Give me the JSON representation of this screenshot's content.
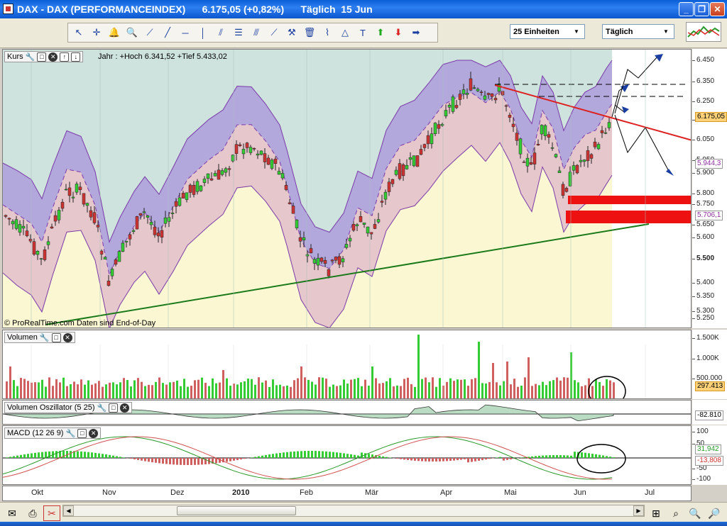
{
  "window": {
    "title": "DAX - DAX (PERFORMANCEINDEX)      6.175,05 (+0,82%)      Täglich  15 Jun",
    "buttons": [
      "_",
      "❐",
      "✕"
    ]
  },
  "toolbar": {
    "units_select": "25 Einheiten",
    "period_select": "Täglich",
    "tools": [
      "cursor-icon",
      "crosshair-icon",
      "alarm-bell-icon",
      "zoom-icon",
      "trendline-icon",
      "line-icon",
      "horizontal-line-icon",
      "vertical-line-icon",
      "channel-icon",
      "fibonacci-icon",
      "parallel-icon",
      "regression-icon",
      "tools-icon",
      "delete-icon",
      "zigzag-icon",
      "triangle-icon",
      "text-icon",
      "up-arrow-icon",
      "down-arrow-icon",
      "right-arrow-icon"
    ]
  },
  "price_panel": {
    "label": "Kurs",
    "info": "Jahr : +Hoch 6.341,52 +Tief 5.433,02",
    "copyright": "© ProRealTime.com  Daten sind End-of-Day",
    "y_ticks": [
      "6.450",
      "6.350",
      "6.250",
      "6.150",
      "6.050",
      "5.950",
      "5.900",
      "5.800",
      "5.750",
      "5.650",
      "5.600",
      "5.500",
      "5.400",
      "5.350",
      "5.300",
      "5.250"
    ],
    "badges": {
      "last": "6.175,05",
      "upper": "5.944,3",
      "lower": "5.706,1"
    }
  },
  "volume_panel": {
    "label": "Volumen",
    "y_ticks": [
      "1.500K",
      "1.000K",
      "500.000"
    ],
    "badge": "297.413"
  },
  "oscillator_panel": {
    "label": "Volumen Oszillator (5 25)",
    "badge": "-82.810"
  },
  "macd_panel": {
    "label": "MACD (12 26 9)",
    "y_ticks": [
      "100",
      "50",
      "0",
      "-50",
      "-100"
    ],
    "badges": {
      "macd": "31,942",
      "signal": "-13,808"
    }
  },
  "x_axis": [
    "Okt",
    "Nov",
    "Dez",
    "2010",
    "Feb",
    "Mär",
    "Apr",
    "Mai",
    "Jun",
    "Jul"
  ],
  "colors": {
    "up": "#33cc33",
    "down": "#cc3333",
    "support": "#1a7a1a",
    "resistance": "#dd2020",
    "band_outer": "#b3a8dc",
    "band_inner": "#e6c7cc",
    "below": "#fbf7d2",
    "bg": "#cfe3de"
  }
}
